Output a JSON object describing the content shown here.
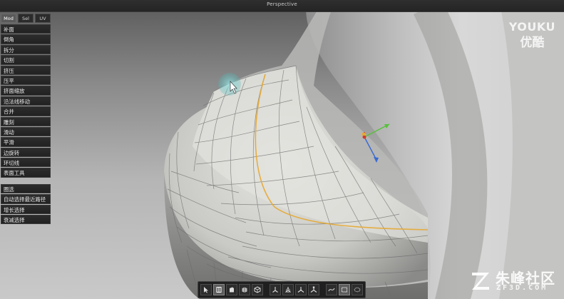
{
  "viewport": {
    "title": "Perspective"
  },
  "panel": {
    "tabs": [
      {
        "label": "Mod",
        "active": true
      },
      {
        "label": "Sel",
        "active": false
      },
      {
        "label": "UV",
        "active": false
      }
    ],
    "tools": [
      "补面",
      "倒角",
      "拆分",
      "切割",
      "挤压",
      "压平",
      "挤面缩放",
      "沿法线移动",
      "合并",
      "雕刻",
      "滑动",
      "平滑",
      "边旋转",
      "环切线",
      "表面工具"
    ],
    "selection_tools": [
      "圈选",
      "自动选择最近路径",
      "增长选择",
      "衰减选择"
    ]
  },
  "toolbar": {
    "buttons": [
      {
        "icon": "select-arrow-icon",
        "active": false
      },
      {
        "icon": "view-front-icon",
        "active": true
      },
      {
        "icon": "view-side-icon",
        "active": false
      },
      {
        "icon": "view-perspective-icon",
        "active": false
      },
      {
        "icon": "cube-icon",
        "active": false
      },
      {
        "icon": "axis-y-icon",
        "active": false
      },
      {
        "icon": "axis-rotate-icon",
        "active": false
      },
      {
        "icon": "axis-xyz-icon",
        "active": false
      },
      {
        "icon": "axis-scale-icon",
        "active": false
      },
      {
        "icon": "curve-select-icon",
        "active": false
      },
      {
        "icon": "rect-select-icon",
        "active": true
      },
      {
        "icon": "lasso-select-icon",
        "active": false
      }
    ]
  },
  "watermarks": {
    "youku_latin": "YOUKU",
    "youku_cn": "优酷",
    "site_cn": "朱峰社区",
    "site_en": "ZF3D.COM"
  },
  "colors": {
    "accent_loop": "#e6a830",
    "gizmo_x": "#d23a2a",
    "gizmo_y": "#58c03a",
    "gizmo_z": "#3a6ad2",
    "brush_cursor": "#7fd6d6"
  }
}
